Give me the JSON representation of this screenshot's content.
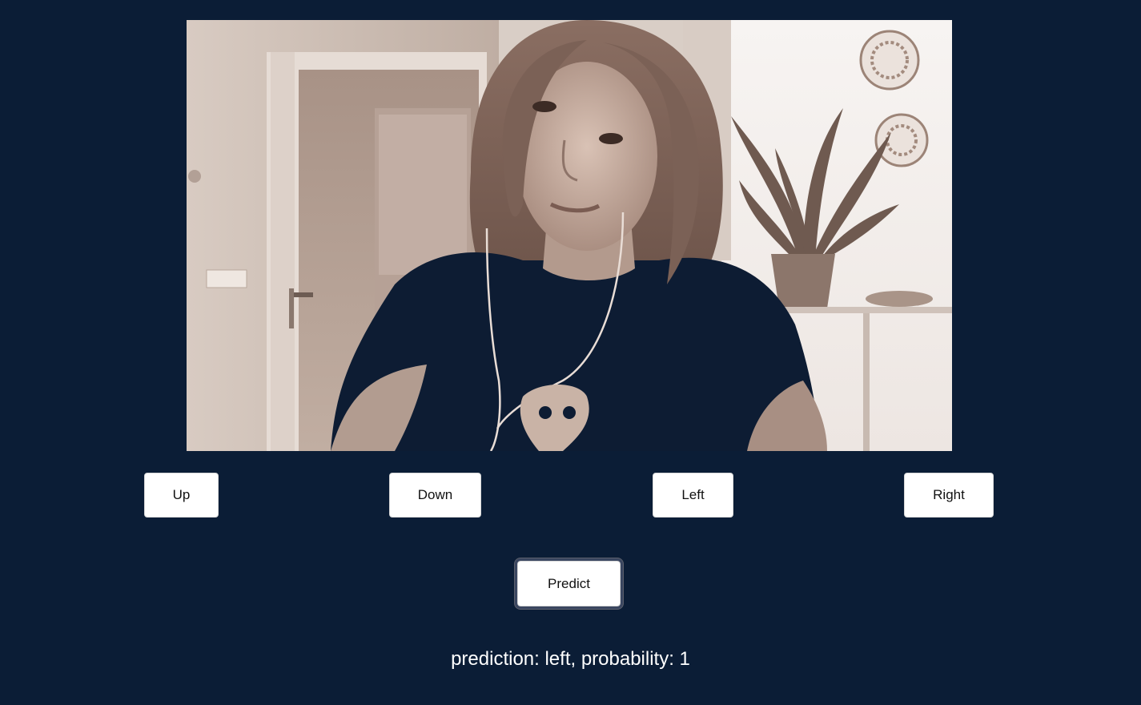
{
  "webcam": {
    "description_icon": "webcam-video-icon"
  },
  "training_buttons": {
    "up": "Up",
    "down": "Down",
    "left": "Left",
    "right": "Right"
  },
  "predict_button": {
    "label": "Predict"
  },
  "result": {
    "text": "prediction: left, probability: 1"
  },
  "colors": {
    "background": "#0b1d36",
    "button": "#ffffff",
    "text": "#ffffff"
  }
}
